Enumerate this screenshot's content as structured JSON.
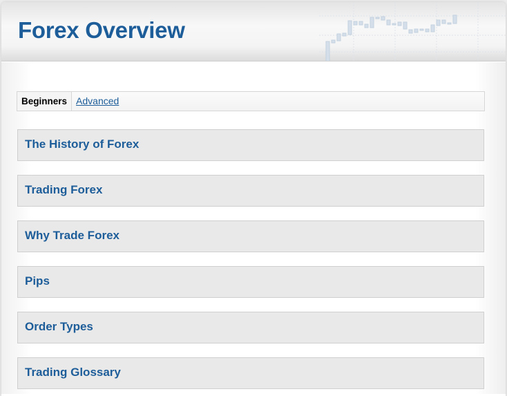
{
  "header": {
    "title": "Forex Overview"
  },
  "tabs": [
    {
      "label": "Beginners",
      "active": true
    },
    {
      "label": "Advanced",
      "active": false
    }
  ],
  "sections": [
    {
      "label": "The History of Forex"
    },
    {
      "label": "Trading Forex"
    },
    {
      "label": "Why Trade Forex"
    },
    {
      "label": "Pips"
    },
    {
      "label": "Order Types"
    },
    {
      "label": "Trading Glossary"
    }
  ],
  "colors": {
    "accent": "#1d5d99",
    "section_bg": "#e9e9e9"
  }
}
